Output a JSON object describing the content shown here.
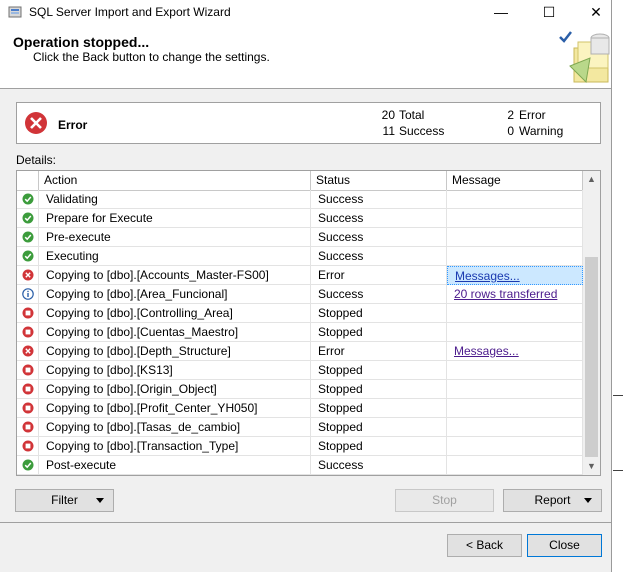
{
  "window": {
    "title": "SQL Server Import and Export Wizard",
    "minimize": "—",
    "maximize": "☐",
    "close": "✕"
  },
  "header": {
    "title": "Operation stopped...",
    "subtitle": "Click the Back button to change the settings."
  },
  "summary": {
    "status": "Error",
    "total_count": "20",
    "total_label": "Total",
    "success_count": "11",
    "success_label": "Success",
    "error_count": "2",
    "error_label": "Error",
    "warning_count": "0",
    "warning_label": "Warning"
  },
  "details": {
    "label": "Details:",
    "columns": {
      "action": "Action",
      "status": "Status",
      "message": "Message"
    },
    "rows": [
      {
        "icon": "success",
        "action": "Validating",
        "status": "Success",
        "message": ""
      },
      {
        "icon": "success",
        "action": "Prepare for Execute",
        "status": "Success",
        "message": ""
      },
      {
        "icon": "success",
        "action": "Pre-execute",
        "status": "Success",
        "message": ""
      },
      {
        "icon": "success",
        "action": "Executing",
        "status": "Success",
        "message": ""
      },
      {
        "icon": "error",
        "action": "Copying to [dbo].[Accounts_Master-FS00]",
        "status": "Error",
        "message": "Messages..."
      },
      {
        "icon": "info",
        "action": "Copying to [dbo].[Area_Funcional]",
        "status": "Success",
        "message": "20 rows transferred"
      },
      {
        "icon": "stopped",
        "action": "Copying to [dbo].[Controlling_Area]",
        "status": "Stopped",
        "message": ""
      },
      {
        "icon": "stopped",
        "action": "Copying to [dbo].[Cuentas_Maestro]",
        "status": "Stopped",
        "message": ""
      },
      {
        "icon": "error",
        "action": "Copying to [dbo].[Depth_Structure]",
        "status": "Error",
        "message": "Messages..."
      },
      {
        "icon": "stopped",
        "action": "Copying to [dbo].[KS13]",
        "status": "Stopped",
        "message": ""
      },
      {
        "icon": "stopped",
        "action": "Copying to [dbo].[Origin_Object]",
        "status": "Stopped",
        "message": ""
      },
      {
        "icon": "stopped",
        "action": "Copying to [dbo].[Profit_Center_YH050]",
        "status": "Stopped",
        "message": ""
      },
      {
        "icon": "stopped",
        "action": "Copying to [dbo].[Tasas_de_cambio]",
        "status": "Stopped",
        "message": ""
      },
      {
        "icon": "stopped",
        "action": "Copying to [dbo].[Transaction_Type]",
        "status": "Stopped",
        "message": ""
      },
      {
        "icon": "success",
        "action": "Post-execute",
        "status": "Success",
        "message": ""
      }
    ]
  },
  "buttons": {
    "filter": "Filter",
    "stop": "Stop",
    "report": "Report",
    "back": "< Back",
    "close": "Close"
  },
  "colors": {
    "success": "#3c9c3c",
    "error": "#d13438",
    "info": "#2b5fa8",
    "selection": "#cce8ff"
  }
}
